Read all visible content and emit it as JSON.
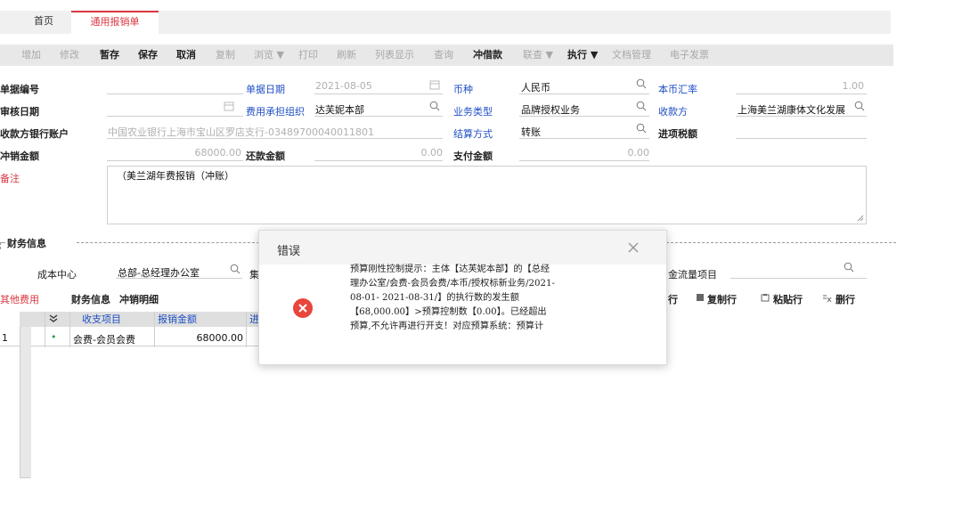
{
  "tabs": {
    "home": "首页",
    "active": "通用报销单"
  },
  "toolbar": [
    {
      "label": "增加",
      "enabled": false
    },
    {
      "label": "修改",
      "enabled": false
    },
    {
      "label": "暂存",
      "enabled": true
    },
    {
      "label": "保存",
      "enabled": true
    },
    {
      "label": "取消",
      "enabled": true
    },
    {
      "label": "复制",
      "enabled": false
    },
    {
      "label": "浏览 ▼",
      "enabled": false
    },
    {
      "label": "打印",
      "enabled": false
    },
    {
      "label": "刷新",
      "enabled": false
    },
    {
      "label": "列表显示",
      "enabled": false
    },
    {
      "label": "查询",
      "enabled": false
    },
    {
      "label": "冲借款",
      "enabled": true
    },
    {
      "label": "联查 ▼",
      "enabled": false
    },
    {
      "label": "执行 ▼",
      "enabled": true
    },
    {
      "label": "文档管理",
      "enabled": false
    },
    {
      "label": "电子发票",
      "enabled": false
    }
  ],
  "form": {
    "bill_no_label": "单据编号",
    "bill_date_label": "单据日期",
    "bill_date_value": "2021-08-05",
    "currency_label": "币种",
    "currency_value": "人民币",
    "exchange_rate_label": "本币汇率",
    "exchange_rate_value": "1.00",
    "audit_date_label": "审核日期",
    "cost_org_label": "费用承担组织",
    "cost_org_value": "达芙妮本部",
    "biz_type_label": "业务类型",
    "biz_type_value": "品牌授权业务",
    "payee_label": "收款方",
    "payee_value": "上海美兰湖康体文化发展",
    "bank_account_label": "收款方银行账户",
    "bank_account_value": "中国农业银行上海市宝山区罗店支行-03489700040011801",
    "settle_label": "结算方式",
    "settle_value": "转账",
    "input_tax_label": "进项税额",
    "offset_amount_label": "冲销金额",
    "offset_amount_value": "68000.00",
    "repay_label": "还款金额",
    "repay_value": "0.00",
    "pay_amount_label": "支付金额",
    "pay_amount_value": "0.00",
    "remark_label": "备注",
    "remark_value": "（美兰湖年费报销（冲账）"
  },
  "finance": {
    "section_label": "财务信息",
    "cost_center_label": "成本中心",
    "cost_center_value": "总部-总经理办公室",
    "cut_label": "集",
    "cashflow_label": "金流量项目"
  },
  "subtabs": {
    "other": "其他费用",
    "finance": "财务信息",
    "offset": "冲销明细"
  },
  "grid": {
    "headers": [
      "收支项目",
      "报销金额",
      "进"
    ],
    "rows": [
      {
        "no": "1",
        "item": "会费-会员会费",
        "amount": "68000.00"
      }
    ],
    "actions": [
      "行",
      "复制行",
      "粘贴行",
      "删行"
    ]
  },
  "dialog": {
    "title": "错误",
    "message": "预算刚性控制提示：主体【达芙妮本部】的【总经理办公室/会费-会员会费/本币/授权标新业务/2021-08-01- 2021-08-31/】的执行数的发生额【68,000.00】>预算控制数【0.00】。已经超出预算,不允许再进行开支！对应预算系统：预算计"
  },
  "colors": {
    "accent": "#d9373f",
    "link": "#1f4fc4",
    "error": "#e8453c"
  }
}
